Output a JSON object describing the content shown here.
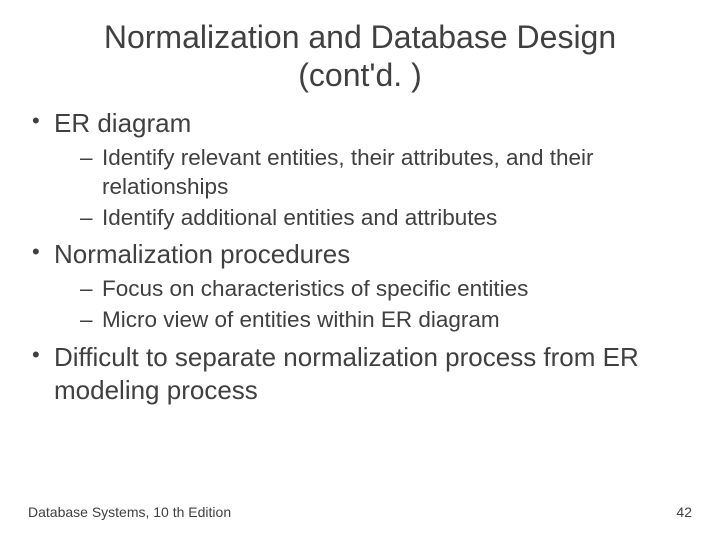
{
  "title_line1": "Normalization and Database Design",
  "title_line2": "(cont'd. )",
  "bullets": {
    "b1": "ER diagram",
    "b1_1": "Identify relevant entities, their attributes, and their relationships",
    "b1_2": "Identify additional entities and attributes",
    "b2": "Normalization procedures",
    "b2_1": "Focus on characteristics of specific entities",
    "b2_2": "Micro view of entities within ER diagram",
    "b3": "Difficult to separate normalization process from ER modeling process"
  },
  "footer_left": "Database Systems, 10 th Edition",
  "footer_right": "42"
}
